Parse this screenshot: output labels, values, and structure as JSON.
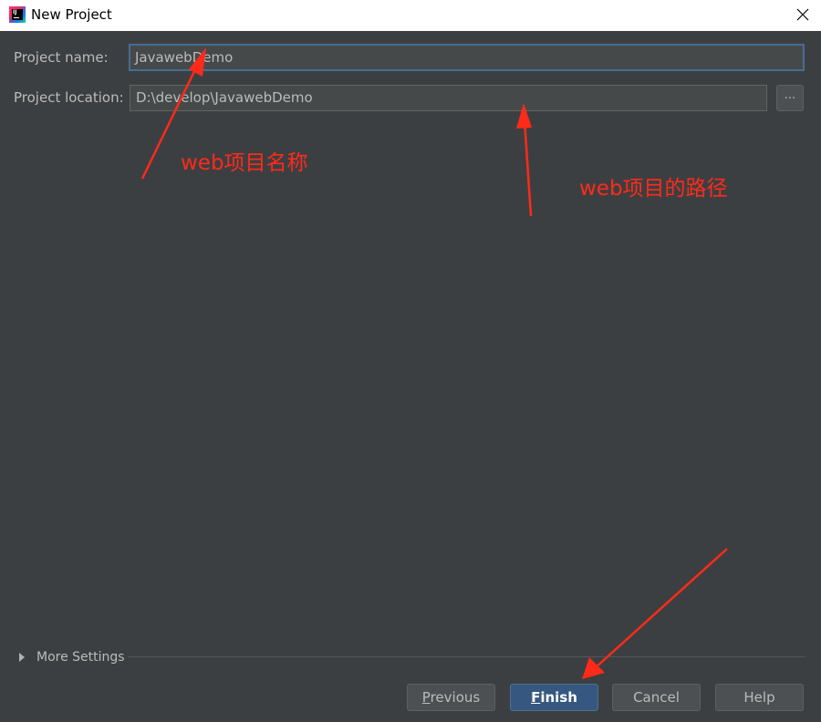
{
  "window": {
    "title": "New Project",
    "app_icon": "intellij-idea-icon",
    "close_icon": "close-icon"
  },
  "form": {
    "project_name_label": "Project name:",
    "project_name_value": "JavawebDemo",
    "project_location_label": "Project location:",
    "project_location_value": "D:\\develop\\JavawebDemo",
    "browse_label": "..."
  },
  "annotations": {
    "name_note": "web项目名称",
    "path_note": "web项目的路径",
    "color": "#ff2a1a"
  },
  "more_settings": {
    "label": "More Settings",
    "expanded": false
  },
  "buttons": {
    "previous": {
      "mnemonic": "P",
      "rest": "revious",
      "enabled": false
    },
    "finish": {
      "mnemonic": "F",
      "rest": "inish",
      "default": true
    },
    "cancel": "Cancel",
    "help": "Help"
  },
  "colors": {
    "background": "#3c3f41",
    "default_button": "#365880",
    "focus_border": "#466d94"
  }
}
